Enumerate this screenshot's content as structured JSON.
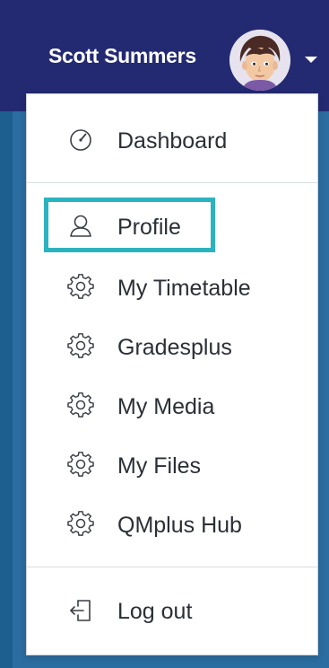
{
  "header": {
    "user_name": "Scott Summers",
    "accent_color": "#232a72"
  },
  "menu": {
    "items": [
      {
        "label": "Dashboard",
        "icon": "speedometer-icon"
      },
      {
        "label": "Profile",
        "icon": "user-icon",
        "focused": true
      },
      {
        "label": "My Timetable",
        "icon": "gear-icon"
      },
      {
        "label": "Gradesplus",
        "icon": "gear-icon"
      },
      {
        "label": "My Media",
        "icon": "gear-icon"
      },
      {
        "label": "My Files",
        "icon": "gear-icon"
      },
      {
        "label": "QMplus Hub",
        "icon": "gear-icon"
      },
      {
        "label": "Log out",
        "icon": "logout-icon"
      }
    ],
    "focus_color": "#2bb3c0"
  }
}
